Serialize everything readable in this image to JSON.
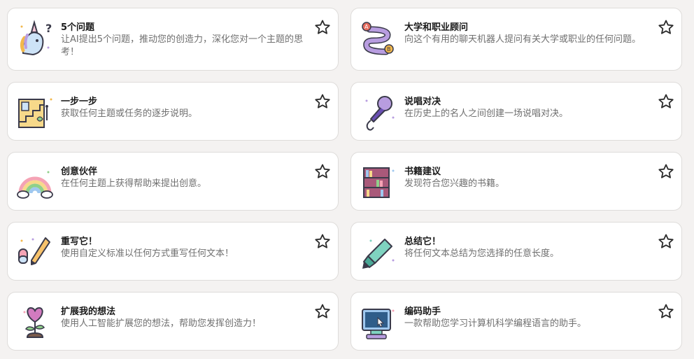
{
  "colors": {
    "background": "#f4f2f1",
    "card": "#ffffff",
    "title": "#1a1a1a",
    "desc": "#6f6f6f"
  },
  "cards": [
    {
      "title": "5个问题",
      "desc": "让AI提出5个问题，推动您的创造力，深化您对一个主题的思考！",
      "icon": "unicorn-icon"
    },
    {
      "title": "大学和职业顾问",
      "desc": "向这个有用的聊天机器人提问有关大学或职业的任何问题。",
      "icon": "road-map-icon"
    },
    {
      "title": "一步一步",
      "desc": "获取任何主题或任务的逐步说明。",
      "icon": "stairs-icon"
    },
    {
      "title": "说唱对决",
      "desc": "在历史上的名人之间创建一场说唱对决。",
      "icon": "microphone-icon"
    },
    {
      "title": "创意伙伴",
      "desc": "在任何主题上获得帮助来提出创意。",
      "icon": "rainbow-icon"
    },
    {
      "title": "书籍建议",
      "desc": "发现符合您兴趣的书籍。",
      "icon": "bookshelf-icon"
    },
    {
      "title": "重写它！",
      "desc": "使用自定义标准以任何方式重写任何文本！",
      "icon": "pencil-eraser-icon"
    },
    {
      "title": "总结它！",
      "desc": "将任何文本总结为您选择的任意长度。",
      "icon": "highlighter-icon"
    },
    {
      "title": "扩展我的想法",
      "desc": "使用人工智能扩展您的想法，帮助您发挥创造力！",
      "icon": "heart-plant-icon"
    },
    {
      "title": "编码助手",
      "desc": "一款帮助您学习计算机科学编程语言的助手。",
      "icon": "computer-icon"
    }
  ]
}
